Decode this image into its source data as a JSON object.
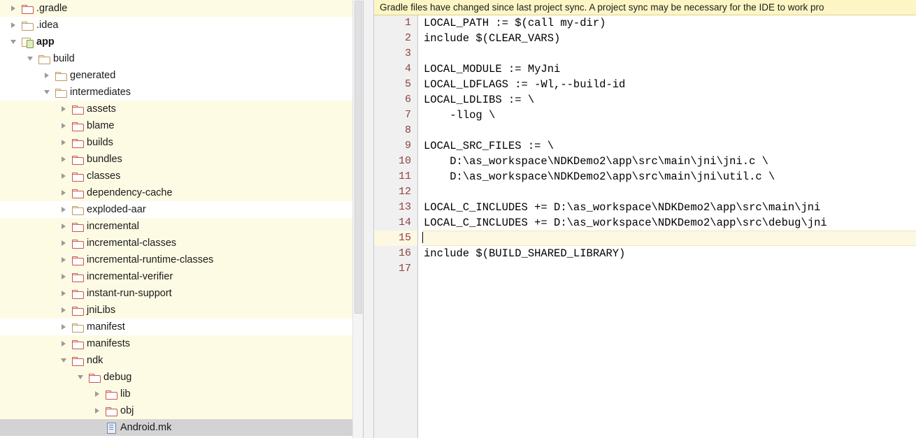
{
  "project_tree": {
    "rows": [
      {
        "label": ".gradle",
        "indent": 0,
        "twisty": "collapsed",
        "icon": "folder-red",
        "bg": "yellow",
        "bold": false
      },
      {
        "label": ".idea",
        "indent": 0,
        "twisty": "collapsed",
        "icon": "folder-tan",
        "bg": "white",
        "bold": false
      },
      {
        "label": "app",
        "indent": 0,
        "twisty": "expanded",
        "icon": "module",
        "bg": "white",
        "bold": true
      },
      {
        "label": "build",
        "indent": 1,
        "twisty": "expanded",
        "icon": "folder-tan",
        "bg": "white",
        "bold": false
      },
      {
        "label": "generated",
        "indent": 2,
        "twisty": "collapsed",
        "icon": "folder-tan",
        "bg": "white",
        "bold": false
      },
      {
        "label": "intermediates",
        "indent": 2,
        "twisty": "expanded",
        "icon": "folder-tan",
        "bg": "white",
        "bold": false
      },
      {
        "label": "assets",
        "indent": 3,
        "twisty": "collapsed",
        "icon": "folder-red",
        "bg": "yellow",
        "bold": false
      },
      {
        "label": "blame",
        "indent": 3,
        "twisty": "collapsed",
        "icon": "folder-red",
        "bg": "yellow",
        "bold": false
      },
      {
        "label": "builds",
        "indent": 3,
        "twisty": "collapsed",
        "icon": "folder-red",
        "bg": "yellow",
        "bold": false
      },
      {
        "label": "bundles",
        "indent": 3,
        "twisty": "collapsed",
        "icon": "folder-red",
        "bg": "yellow",
        "bold": false
      },
      {
        "label": "classes",
        "indent": 3,
        "twisty": "collapsed",
        "icon": "folder-red",
        "bg": "yellow",
        "bold": false
      },
      {
        "label": "dependency-cache",
        "indent": 3,
        "twisty": "collapsed",
        "icon": "folder-red",
        "bg": "yellow",
        "bold": false
      },
      {
        "label": "exploded-aar",
        "indent": 3,
        "twisty": "collapsed",
        "icon": "folder-tan",
        "bg": "white",
        "bold": false
      },
      {
        "label": "incremental",
        "indent": 3,
        "twisty": "collapsed",
        "icon": "folder-red",
        "bg": "yellow",
        "bold": false
      },
      {
        "label": "incremental-classes",
        "indent": 3,
        "twisty": "collapsed",
        "icon": "folder-red",
        "bg": "yellow",
        "bold": false
      },
      {
        "label": "incremental-runtime-classes",
        "indent": 3,
        "twisty": "collapsed",
        "icon": "folder-red",
        "bg": "yellow",
        "bold": false
      },
      {
        "label": "incremental-verifier",
        "indent": 3,
        "twisty": "collapsed",
        "icon": "folder-red",
        "bg": "yellow",
        "bold": false
      },
      {
        "label": "instant-run-support",
        "indent": 3,
        "twisty": "collapsed",
        "icon": "folder-red",
        "bg": "yellow",
        "bold": false
      },
      {
        "label": "jniLibs",
        "indent": 3,
        "twisty": "collapsed",
        "icon": "folder-red",
        "bg": "yellow",
        "bold": false
      },
      {
        "label": "manifest",
        "indent": 3,
        "twisty": "collapsed",
        "icon": "folder-tan",
        "bg": "white",
        "bold": false
      },
      {
        "label": "manifests",
        "indent": 3,
        "twisty": "collapsed",
        "icon": "folder-red",
        "bg": "yellow",
        "bold": false
      },
      {
        "label": "ndk",
        "indent": 3,
        "twisty": "expanded",
        "icon": "folder-red",
        "bg": "yellow",
        "bold": false
      },
      {
        "label": "debug",
        "indent": 4,
        "twisty": "expanded",
        "icon": "folder-red",
        "bg": "yellow",
        "bold": false
      },
      {
        "label": "lib",
        "indent": 5,
        "twisty": "collapsed",
        "icon": "folder-red",
        "bg": "yellow",
        "bold": false
      },
      {
        "label": "obj",
        "indent": 5,
        "twisty": "collapsed",
        "icon": "folder-red",
        "bg": "yellow",
        "bold": false
      },
      {
        "label": "Android.mk",
        "indent": 5,
        "twisty": "none",
        "icon": "file",
        "bg": "selected",
        "bold": false
      }
    ]
  },
  "notification": {
    "text": "Gradle files have changed since last project sync. A project sync may be necessary for the IDE to work pro"
  },
  "editor": {
    "line_numbers": [
      "1",
      "2",
      "3",
      "4",
      "5",
      "6",
      "7",
      "8",
      "9",
      "10",
      "11",
      "12",
      "13",
      "14",
      "15",
      "16",
      "17"
    ],
    "current_line": 15,
    "lines": [
      "LOCAL_PATH := $(call my-dir)",
      "include $(CLEAR_VARS)",
      "",
      "LOCAL_MODULE := MyJni",
      "LOCAL_LDFLAGS := -Wl,--build-id",
      "LOCAL_LDLIBS := \\",
      "    -llog \\",
      "",
      "LOCAL_SRC_FILES := \\",
      "    D:\\as_workspace\\NDKDemo2\\app\\src\\main\\jni\\jni.c \\",
      "    D:\\as_workspace\\NDKDemo2\\app\\src\\main\\jni\\util.c \\",
      "",
      "LOCAL_C_INCLUDES += D:\\as_workspace\\NDKDemo2\\app\\src\\main\\jni",
      "LOCAL_C_INCLUDES += D:\\as_workspace\\NDKDemo2\\app\\src\\debug\\jni",
      "",
      "include $(BUILD_SHARED_LIBRARY)",
      ""
    ]
  },
  "colors": {
    "tree_row_highlight": "#fdfbe4",
    "tree_row_selected": "#d3d3d3",
    "notification_bg": "#fdf6c4",
    "gutter_bg": "#f0f0f0",
    "line_number_fg": "#8d4040",
    "current_line_bg": "#fdf8e2",
    "folder_red": "#c8564f",
    "folder_tan": "#bd9a5f"
  }
}
